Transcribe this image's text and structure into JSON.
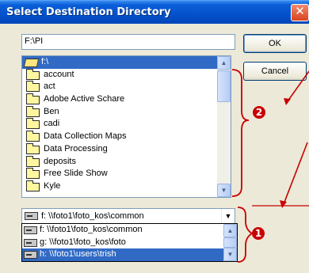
{
  "window": {
    "title": "Select Destination Directory",
    "close_glyph": "✕"
  },
  "path_field": {
    "value": "F:\\PI"
  },
  "buttons": {
    "ok": "OK",
    "cancel": "Cancel"
  },
  "directory_list": {
    "root": "f:\\",
    "folders": [
      "account",
      "act",
      "Adobe Active Schare",
      "Ben",
      "cadi",
      "Data Collection Maps",
      "Data Processing",
      "deposits",
      "Free Slide Show",
      "Kyle"
    ]
  },
  "drive_combo": {
    "value": "f:  \\\\foto1\\foto_kos\\common"
  },
  "drive_options": [
    "f:  \\\\foto1\\foto_kos\\common",
    "g:  \\\\foto1\\foto_kos\\foto",
    "h:  \\\\foto1\\users\\trish"
  ],
  "annotations": {
    "marker_1": "❶",
    "marker_2": "❷",
    "color": "#c80000"
  },
  "icons": {
    "open_folder": "open-folder-icon",
    "folder": "folder-icon",
    "drive": "network-drive-icon",
    "scroll_up": "▲",
    "scroll_down": "▼",
    "combo_down": "▼"
  },
  "colors": {
    "titlebar": "#0551cc",
    "selection": "#316ac5",
    "annotation": "#c80000"
  }
}
